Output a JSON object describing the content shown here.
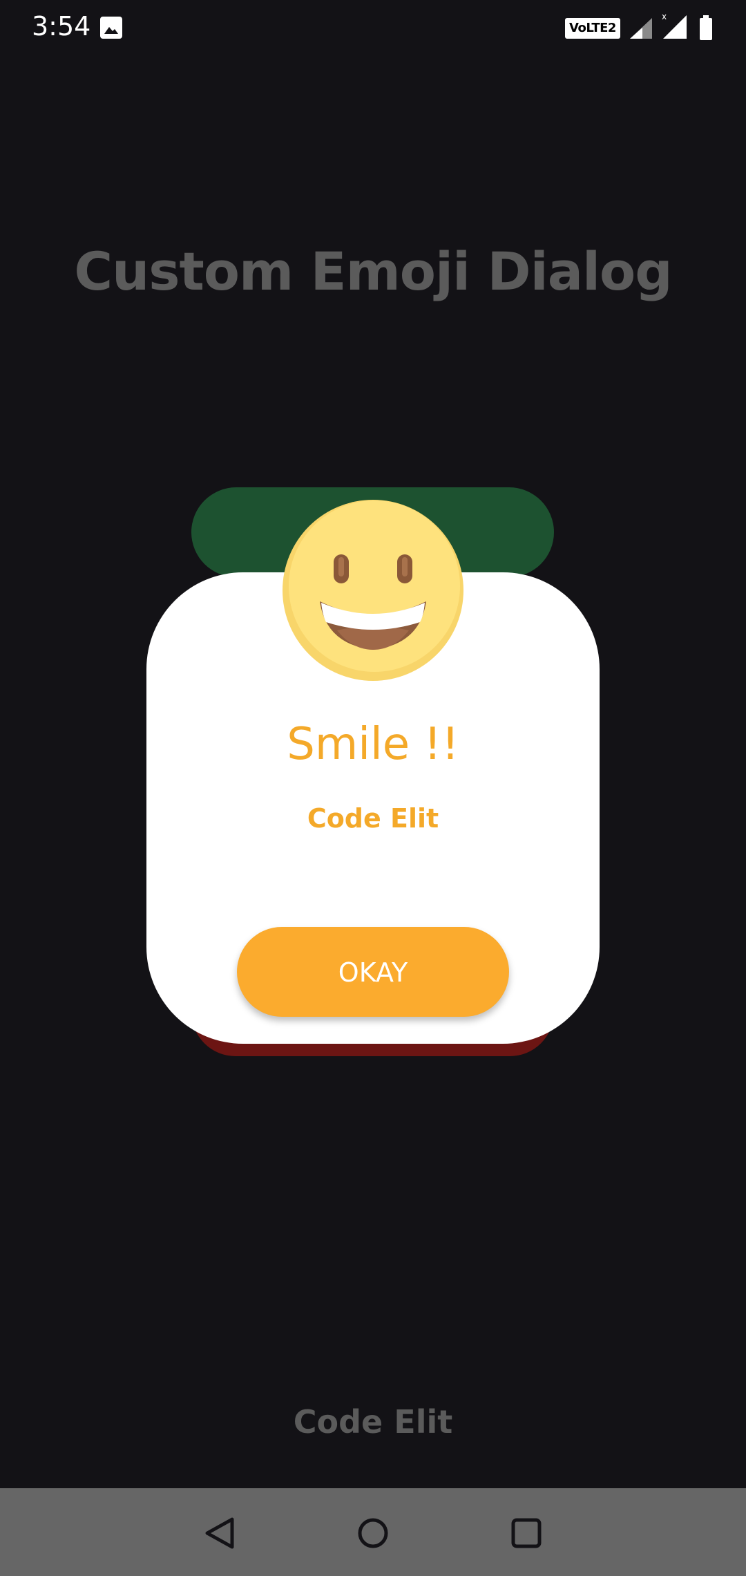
{
  "status_bar": {
    "time": "3:54",
    "volte_label": "VoLTE2",
    "icons": [
      "gallery-icon",
      "signal-icon",
      "signal-roaming-icon",
      "battery-icon"
    ]
  },
  "app": {
    "title": "Custom Emoji Dialog",
    "footer": "Code Elit"
  },
  "dialog": {
    "emoji": "grinning-face-icon",
    "title": "Smile !!",
    "subtitle": "Code Elit",
    "button_label": "OKAY",
    "colors": {
      "accent": "#fbab2e",
      "top_band": "#1d5230",
      "bottom_band": "#6c1513",
      "card": "#ffffff"
    }
  },
  "nav_bar": {
    "icons": [
      "back-icon",
      "home-icon",
      "recents-icon"
    ]
  },
  "colors": {
    "background": "#131216",
    "muted_text": "#5b5b5b",
    "nav_bar": "#666666"
  }
}
